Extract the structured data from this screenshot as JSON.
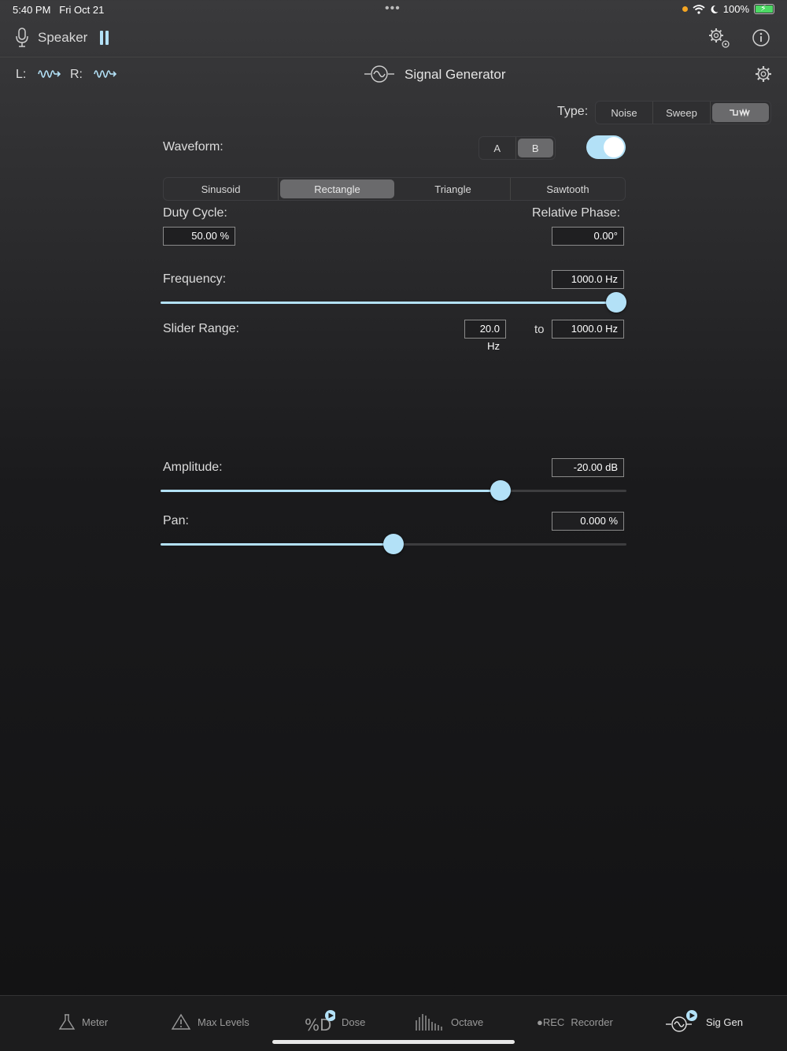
{
  "status": {
    "time": "5:40 PM",
    "date": "Fri Oct 21",
    "dots": "•••",
    "battery": "100%"
  },
  "header": {
    "output_label": "Speaker",
    "icons": [
      "mic-icon",
      "pause-icon",
      "settings-gear-icon",
      "info-icon"
    ]
  },
  "subheader": {
    "left_label": "L:",
    "right_label": "R:",
    "title": "Signal Generator"
  },
  "type": {
    "label": "Type:",
    "options": [
      "Noise",
      "Sweep",
      "waveform-glyph"
    ],
    "selected_index": 2
  },
  "waveform": {
    "label": "Waveform:",
    "ab_options": [
      "A",
      "B"
    ],
    "ab_selected": "B",
    "enabled": true,
    "shapes": [
      "Sinusoid",
      "Rectangle",
      "Triangle",
      "Sawtooth"
    ],
    "shape_selected": "Rectangle"
  },
  "duty_cycle": {
    "label": "Duty Cycle:",
    "value": "50.00 %"
  },
  "relative_phase": {
    "label": "Relative Phase:",
    "value": "0.00°"
  },
  "frequency": {
    "label": "Frequency:",
    "value": "1000.0 Hz",
    "slider_fraction": 1.0
  },
  "slider_range": {
    "label": "Slider Range:",
    "min": "20.0 Hz",
    "to": "to",
    "max": "1000.0 Hz"
  },
  "amplitude": {
    "label": "Amplitude:",
    "value": "-20.00 dB",
    "slider_fraction": 0.74
  },
  "pan": {
    "label": "Pan:",
    "value": "0.000 %",
    "slider_fraction": 0.5
  },
  "tabs": [
    {
      "label": "Meter",
      "icon": "flask-icon",
      "active": false
    },
    {
      "label": "Max Levels",
      "icon": "warning-triangle-icon",
      "active": false
    },
    {
      "label": "Dose",
      "icon": "dose-icon",
      "active": false
    },
    {
      "label": "Octave",
      "icon": "octave-bars-icon",
      "active": false
    },
    {
      "label": "Recorder",
      "icon_text": "●REC",
      "active": false
    },
    {
      "label": "Sig Gen",
      "icon": "sig-gen-icon",
      "active": true
    }
  ],
  "colors": {
    "accent": "#b3e1f7"
  }
}
